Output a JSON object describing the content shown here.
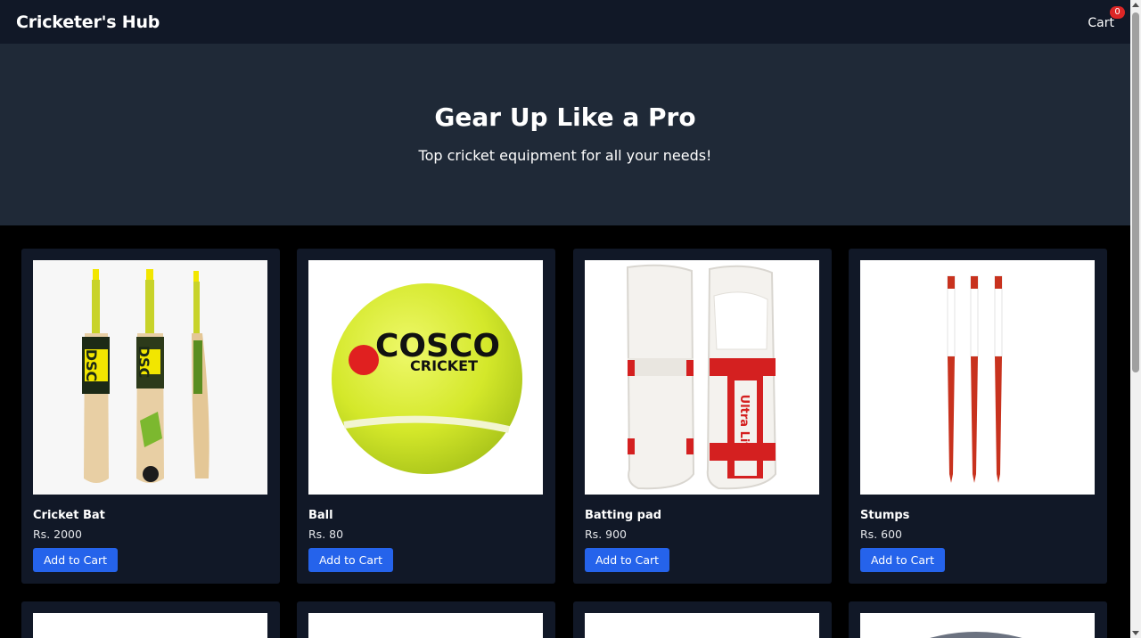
{
  "navbar": {
    "brand": "Cricketer's Hub",
    "cart_label": "Cart",
    "cart_count": "0"
  },
  "hero": {
    "title": "Gear Up Like a Pro",
    "subtitle": "Top cricket equipment for all your needs!"
  },
  "products": [
    {
      "name": "Cricket Bat",
      "price": "Rs. 2000",
      "button": "Add to Cart",
      "image": "cricket-bat-image"
    },
    {
      "name": "Ball",
      "price": "Rs. 80",
      "button": "Add to Cart",
      "image": "tennis-ball-image"
    },
    {
      "name": "Batting pad",
      "price": "Rs. 900",
      "button": "Add to Cart",
      "image": "batting-pad-image"
    },
    {
      "name": "Stumps",
      "price": "Rs. 600",
      "button": "Add to Cart",
      "image": "stumps-image"
    }
  ],
  "colors": {
    "navbar_bg": "#111827",
    "hero_bg": "#1f2937",
    "page_bg": "#000000",
    "card_bg": "#111827",
    "button_bg": "#2563eb",
    "badge_bg": "#dc2626"
  }
}
